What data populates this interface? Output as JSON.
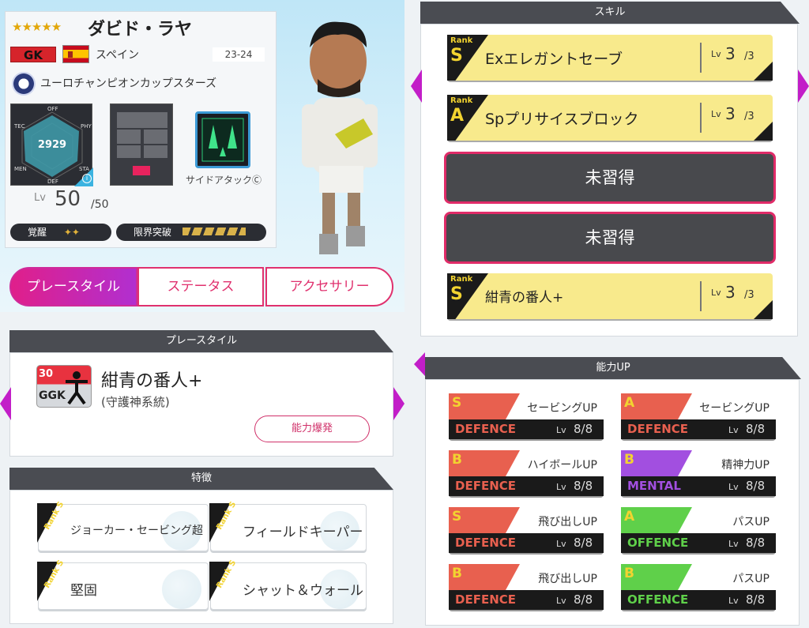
{
  "player": {
    "stars": "★★★★★",
    "name": "ダビド・ラヤ",
    "position": "GK",
    "country": "スペイン",
    "season": "23-24",
    "club": "ユーロチャンピオンカップスターズ",
    "radar_value": "2929",
    "radar_labels": {
      "off": "OFF",
      "phy": "PHY",
      "sta": "STA",
      "def": "DEF",
      "men": "MEN",
      "tec": "TEC"
    },
    "skill_name": "サイドアタック",
    "skill_mark": "Ⓒ",
    "level_label": "Lv",
    "level": "50",
    "level_max": "/50",
    "awaken_label": "覚醒",
    "awaken_marks": "✦✦",
    "limit_label": "限界突破"
  },
  "tabs": [
    "プレースタイル",
    "ステータス",
    "アクセサリー"
  ],
  "playstyle": {
    "header": "プレースタイル",
    "badge_num": "30",
    "badge_code": "GGK",
    "name": "紺青の番人+",
    "sub": "(守護神系統)",
    "button": "能力爆発"
  },
  "traits": {
    "header": "特徴",
    "items": [
      {
        "rank_label": "Rank",
        "rank": "S",
        "label": "ジョーカー・セービング超"
      },
      {
        "rank_label": "Rank",
        "rank": "S",
        "label": "フィールドキーパー"
      },
      {
        "rank_label": "Rank",
        "rank": "S",
        "label": "堅固"
      },
      {
        "rank_label": "Rank",
        "rank": "S",
        "label": "シャット＆ウォール"
      }
    ]
  },
  "skills": {
    "header": "スキル",
    "items": [
      {
        "rank_label": "Rank",
        "rank": "S",
        "name": "Exエレガントセーブ",
        "lv_label": "Lv",
        "lv": "3",
        "lv_max": "/3"
      },
      {
        "rank_label": "Rank",
        "rank": "A",
        "name": "Spプリサイスブロック",
        "lv_label": "Lv",
        "lv": "3",
        "lv_max": "/3"
      }
    ],
    "locked": [
      "未習得",
      "未習得"
    ],
    "last": {
      "rank_label": "Rank",
      "rank": "S",
      "name": "紺青の番人+",
      "lv_label": "Lv",
      "lv": "3",
      "lv_max": "/3"
    }
  },
  "abilities": {
    "header": "能力UP",
    "items": [
      {
        "grade": "S",
        "name": "セービングUP",
        "category": "DEFENCE",
        "lv_label": "Lv",
        "lv": "8/8",
        "color": "#e8604f"
      },
      {
        "grade": "A",
        "name": "セービングUP",
        "category": "DEFENCE",
        "lv_label": "Lv",
        "lv": "8/8",
        "color": "#e8604f"
      },
      {
        "grade": "B",
        "name": "ハイボールUP",
        "category": "DEFENCE",
        "lv_label": "Lv",
        "lv": "8/8",
        "color": "#e8604f"
      },
      {
        "grade": "B",
        "name": "精神力UP",
        "category": "MENTAL",
        "lv_label": "Lv",
        "lv": "8/8",
        "color": "#a24fe0"
      },
      {
        "grade": "S",
        "name": "飛び出しUP",
        "category": "DEFENCE",
        "lv_label": "Lv",
        "lv": "8/8",
        "color": "#e8604f"
      },
      {
        "grade": "A",
        "name": "パスUP",
        "category": "OFFENCE",
        "lv_label": "Lv",
        "lv": "8/8",
        "color": "#5fd04a"
      },
      {
        "grade": "B",
        "name": "飛び出しUP",
        "category": "DEFENCE",
        "lv_label": "Lv",
        "lv": "8/8",
        "color": "#e8604f"
      },
      {
        "grade": "B",
        "name": "パスUP",
        "category": "OFFENCE",
        "lv_label": "Lv",
        "lv": "8/8",
        "color": "#5fd04a"
      }
    ]
  }
}
